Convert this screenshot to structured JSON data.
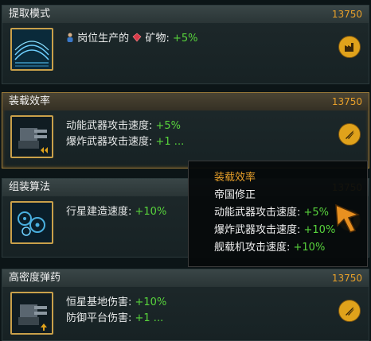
{
  "cards": [
    {
      "title": "提取模式",
      "cost": "13750",
      "lines": [
        {
          "prefix_icon": "person-icon",
          "label": "岗位生产的",
          "mid_icon": "gem-icon",
          "label2": "矿物: ",
          "value": "+5%"
        }
      ],
      "badge_icon": "factory-icon",
      "thumb_icon": "wave-landscape-icon"
    },
    {
      "title": "装载效率",
      "cost": "13750",
      "lines": [
        {
          "label": "动能武器攻击速度: ",
          "value": "+5%"
        },
        {
          "label": "爆炸武器攻击速度: ",
          "value": "+1 ..."
        }
      ],
      "badge_icon": "missiles-icon",
      "thumb_icon": "turret-icon"
    },
    {
      "title": "组装算法",
      "cost": "13750",
      "lines": [
        {
          "label": "行星建造速度: ",
          "value": "+10%"
        }
      ],
      "badge_icon": "factory-icon",
      "thumb_icon": "gears-icon"
    },
    {
      "title": "高密度弹药",
      "cost": "13750",
      "lines": [
        {
          "label": "恒星基地伤害: ",
          "value": "+10%"
        },
        {
          "label": "防御平台伤害: ",
          "value": "+1 ..."
        }
      ],
      "badge_icon": "missiles-icon",
      "thumb_icon": "turret-icon"
    }
  ],
  "tooltip": {
    "title": "装载效率",
    "subtitle": "帝国修正",
    "lines": [
      {
        "label": "动能武器攻击速度: ",
        "value": "+5%"
      },
      {
        "label": "爆炸武器攻击速度: ",
        "value": "+10%"
      },
      {
        "label": "舰载机攻击速度: ",
        "value": "+10%"
      }
    ]
  },
  "colors": {
    "accent": "#e8a02a",
    "positive": "#58d43c",
    "border_selected": "#9a7a3a"
  }
}
